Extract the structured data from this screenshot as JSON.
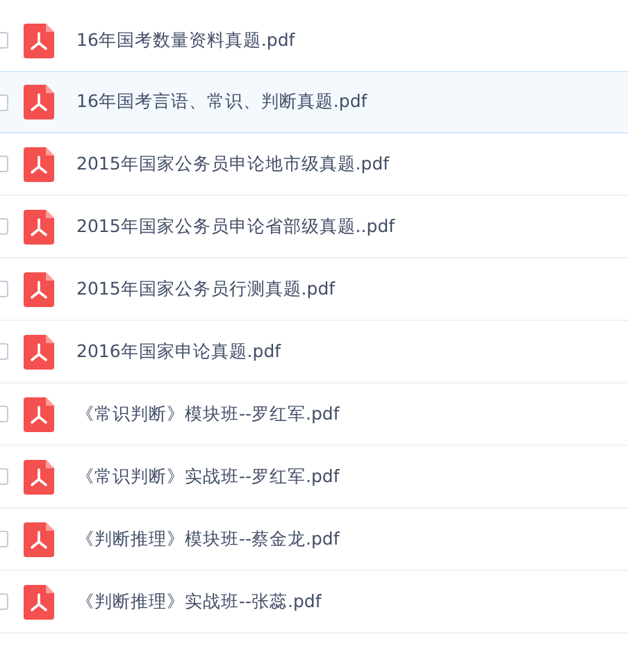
{
  "files": [
    {
      "name": "16年国考数量资料真题.pdf",
      "checked": false,
      "selected": false
    },
    {
      "name": "16年国考言语、常识、判断真题.pdf",
      "checked": false,
      "selected": true
    },
    {
      "name": "2015年国家公务员申论地市级真题.pdf",
      "checked": false,
      "selected": false
    },
    {
      "name": "2015年国家公务员申论省部级真题..pdf",
      "checked": false,
      "selected": false
    },
    {
      "name": "2015年国家公务员行测真题.pdf",
      "checked": false,
      "selected": false
    },
    {
      "name": "2016年国家申论真题.pdf",
      "checked": false,
      "selected": false
    },
    {
      "name": "《常识判断》模块班--罗红军.pdf",
      "checked": false,
      "selected": false
    },
    {
      "name": "《常识判断》实战班--罗红军.pdf",
      "checked": false,
      "selected": false
    },
    {
      "name": "《判断推理》模块班--蔡金龙.pdf",
      "checked": false,
      "selected": false
    },
    {
      "name": "《判断推理》实战班--张蕊.pdf",
      "checked": false,
      "selected": false
    }
  ]
}
